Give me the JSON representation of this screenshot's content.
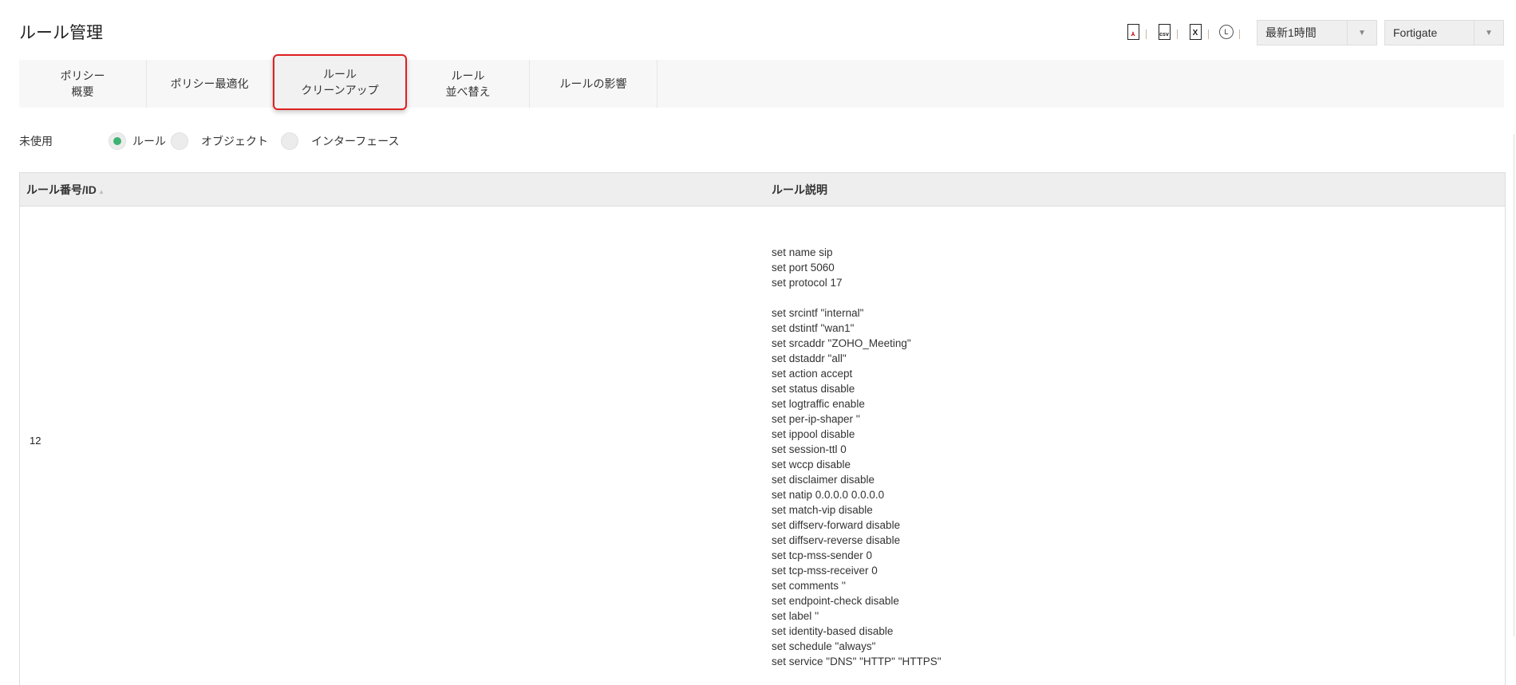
{
  "header": {
    "title": "ルール管理",
    "icons": [
      "pdf-icon",
      "csv-icon",
      "excel-icon",
      "clock-icon"
    ],
    "time_select": "最新1時間",
    "device_select": "Fortigate"
  },
  "tabs": [
    {
      "label": "ポリシー\n概要"
    },
    {
      "label": "ポリシー最適化"
    },
    {
      "label": "ルール\nクリーンアップ"
    },
    {
      "label": "ルール\n並べ替え"
    },
    {
      "label": "ルールの影響"
    }
  ],
  "active_tab": 2,
  "filter": {
    "label": "未使用",
    "options": [
      "ルール",
      "オブジェクト",
      "インターフェース"
    ],
    "selected": "ルール"
  },
  "table": {
    "headers": [
      "ルール番号/ID",
      "ルール説明"
    ],
    "rows": [
      {
        "id": "12",
        "lines": [
          "set name sip",
          "set port 5060",
          "set protocol 17",
          "",
          " set srcintf \"internal\"",
          "set dstintf \"wan1\"",
          "set srcaddr \"ZOHO_Meeting\"",
          "set dstaddr \"all\"",
          "set action accept",
          "set status disable",
          "set logtraffic enable",
          "set per-ip-shaper ''",
          "set ippool disable",
          "set session-ttl 0",
          "set wccp disable",
          "set disclaimer disable",
          "set natip 0.0.0.0 0.0.0.0",
          "set match-vip disable",
          "set diffserv-forward disable",
          "set diffserv-reverse disable",
          "set tcp-mss-sender 0",
          "set tcp-mss-receiver 0",
          "set comments ''",
          "set endpoint-check disable",
          "set label ''",
          "set identity-based disable",
          "set schedule \"always\"",
          "set service \"DNS\" \"HTTP\" \"HTTPS\""
        ]
      }
    ]
  },
  "colors": {
    "accent": "#3cb371",
    "highlight": "#e02020"
  }
}
